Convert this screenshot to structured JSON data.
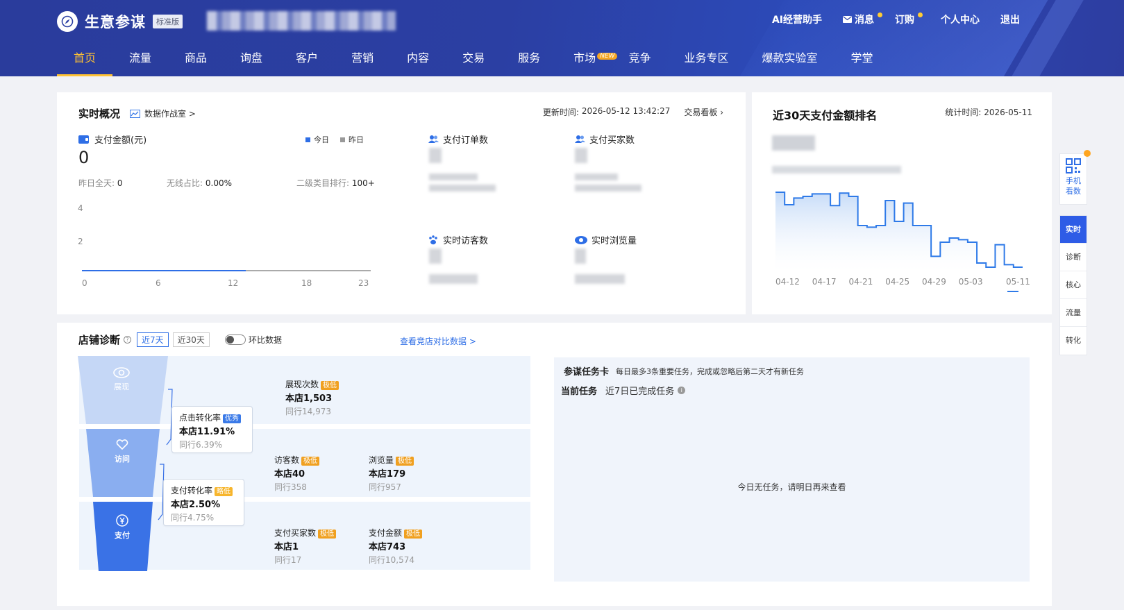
{
  "header": {
    "logo_name": "生意参谋",
    "edition": "标准版",
    "top_links": [
      "AI经营助手",
      "消息",
      "订购",
      "个人中心",
      "退出"
    ],
    "nav": [
      "首页",
      "流量",
      "商品",
      "询盘",
      "客户",
      "营销",
      "内容",
      "交易",
      "服务",
      "市场",
      "竞争",
      "业务专区",
      "爆款实验室",
      "学堂"
    ],
    "new_badge": "NEW"
  },
  "realtime": {
    "title": "实时概况",
    "war_room": "数据作战室 >",
    "update_label": "更新时间:",
    "update_time": "2026-05-12 13:42:27",
    "board_link": "交易看板",
    "pay_amount_label": "支付金额(元)",
    "legend_today": "今日",
    "legend_yesterday": "昨日",
    "pay_amount_value": "0",
    "yesterday_label": "昨日全天:",
    "yesterday_value": "0",
    "wireless_label": "无线占比:",
    "wireless_value": "0.00%",
    "rank_label": "二级类目排行:",
    "rank_value": "100+",
    "pay_orders_label": "支付订单数",
    "pay_buyers_label": "支付买家数",
    "visitors_label": "实时访客数",
    "pageviews_label": "实时浏览量"
  },
  "mini_chart": {
    "y_ticks": [
      "4",
      "2"
    ],
    "x_ticks": [
      "0",
      "6",
      "12",
      "18",
      "23"
    ]
  },
  "ranking": {
    "title": "近30天支付金额排名",
    "stat_label": "统计时间:",
    "stat_date": "2026-05-11"
  },
  "chart_data": {
    "type": "line",
    "title": "",
    "x_ticks": [
      "04-12",
      "04-17",
      "04-21",
      "04-25",
      "04-29",
      "05-03",
      "05-11"
    ],
    "values": [
      95,
      80,
      88,
      90,
      93,
      93,
      79,
      94,
      90,
      55,
      53,
      55,
      85,
      60,
      82,
      55,
      55,
      18,
      35,
      40,
      38,
      35,
      10,
      5,
      32,
      8,
      5
    ],
    "grid": false,
    "step": true
  },
  "diagnosis": {
    "title": "店铺诊断",
    "tab_7": "近7天",
    "tab_30": "近30天",
    "toggle_label": "环比数据",
    "compare_link": "查看竞店对比数据 >",
    "funnel": {
      "exposure": "展现",
      "visit": "访问",
      "pay": "支付"
    },
    "click_rate": {
      "label": "点击转化率",
      "tag": "优秀",
      "store": "本店11.91%",
      "peer": "同行6.39%"
    },
    "pay_rate": {
      "label": "支付转化率",
      "tag": "略低",
      "store": "本店2.50%",
      "peer": "同行4.75%"
    },
    "impressions": {
      "label": "展现次数",
      "tag": "极低",
      "store": "本店1,503",
      "peer": "同行14,973"
    },
    "visitors": {
      "label": "访客数",
      "tag": "极低",
      "store": "本店40",
      "peer": "同行358"
    },
    "pageviews": {
      "label": "浏览量",
      "tag": "极低",
      "store": "本店179",
      "peer": "同行957"
    },
    "buyers": {
      "label": "支付买家数",
      "tag": "极低",
      "store": "本店1",
      "peer": "同行17"
    },
    "amount": {
      "label": "支付金额",
      "tag": "极低",
      "store": "本店743",
      "peer": "同行10,574"
    }
  },
  "task": {
    "title": "参谋任务卡",
    "subtitle": "每日最多3条重要任务，完成或忽略后第二天才有新任务",
    "current_label": "当前任务",
    "current_value": "近7日已完成任务",
    "empty": "今日无任务，请明日再来查看"
  },
  "sidebar": {
    "phone_line1": "手机",
    "phone_line2": "看数",
    "tabs": [
      "实时",
      "诊断",
      "核心",
      "流量",
      "转化"
    ]
  },
  "colors": {
    "header": "#2b3fa3",
    "accent": "#ffc233",
    "primary": "#2e6ee6"
  }
}
